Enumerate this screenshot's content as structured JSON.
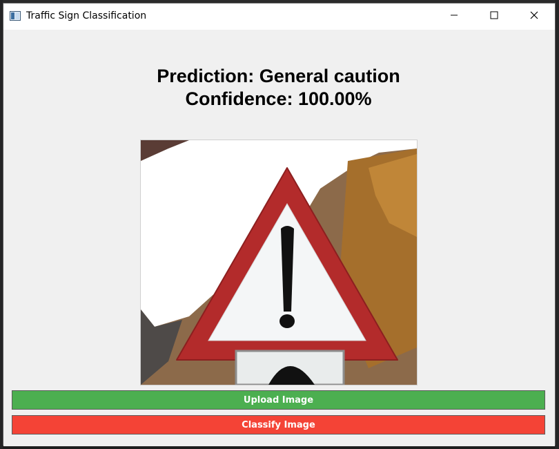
{
  "window": {
    "title": "Traffic Sign Classification",
    "controls": [
      "minimize-icon",
      "maximize-icon",
      "close-icon"
    ]
  },
  "result": {
    "prediction_line": "Prediction: General caution",
    "confidence_line": "Confidence: 100.00%"
  },
  "image": {
    "description_icon": "general-caution-sign"
  },
  "buttons": {
    "upload_label": "Upload Image",
    "classify_label": "Classify Image"
  },
  "colors": {
    "upload": "#4caf50",
    "classify": "#f44336",
    "background": "#f0f0f0"
  }
}
